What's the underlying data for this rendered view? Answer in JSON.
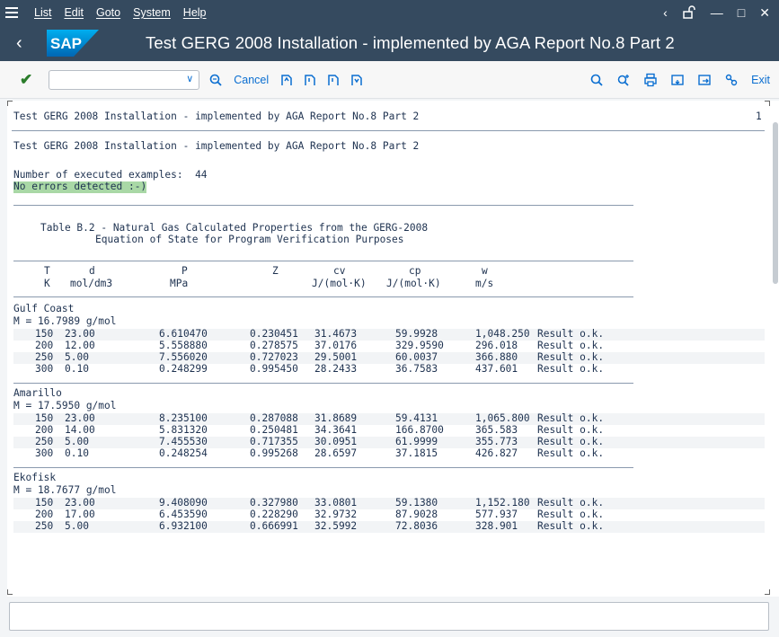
{
  "menubar": {
    "items": [
      "List",
      "Edit",
      "Goto",
      "System",
      "Help"
    ]
  },
  "titlebar": {
    "logo_text": "SAP",
    "title": "Test GERG 2008 Installation - implemented by AGA Report No.8 Part 2"
  },
  "toolbar": {
    "command_field_value": "",
    "cancel_label": "Cancel",
    "exit_label": "Exit"
  },
  "report": {
    "list_header": "Test GERG 2008 Installation - implemented by AGA Report No.8 Part 2",
    "page_number": "1",
    "title_line": "Test GERG 2008 Installation - implemented by AGA Report No.8 Part 2",
    "executed_examples": "Number of executed examples:  44",
    "no_errors": "No errors detected :-)",
    "table_title_1": "Table B.2 - Natural Gas Calculated Properties from the GERG-2008",
    "table_title_2": "Equation of State for Program Verification Purposes",
    "columns": [
      {
        "sym": "T",
        "unit": "K"
      },
      {
        "sym": "d",
        "unit": "mol/dm3"
      },
      {
        "sym": "P",
        "unit": "MPa"
      },
      {
        "sym": "Z",
        "unit": ""
      },
      {
        "sym": "cv",
        "unit": "J/(mol·K)"
      },
      {
        "sym": "cp",
        "unit": "J/(mol·K)"
      },
      {
        "sym": "w",
        "unit": "m/s"
      }
    ],
    "groups": [
      {
        "name": "Gulf Coast",
        "molar_mass": "M = 16.7989 g/mol",
        "rows": [
          [
            "150",
            "23.00",
            "6.610470",
            "0.230451",
            "31.4673",
            "59.9928",
            "1,048.250",
            "Result o.k."
          ],
          [
            "200",
            "12.00",
            "5.558880",
            "0.278575",
            "37.0176",
            "329.9590",
            "296.018",
            "Result o.k."
          ],
          [
            "250",
            "5.00",
            "7.556020",
            "0.727023",
            "29.5001",
            "60.0037",
            "366.880",
            "Result o.k."
          ],
          [
            "300",
            "0.10",
            "0.248299",
            "0.995450",
            "28.2433",
            "36.7583",
            "437.601",
            "Result o.k."
          ]
        ]
      },
      {
        "name": "Amarillo",
        "molar_mass": "M = 17.5950 g/mol",
        "rows": [
          [
            "150",
            "23.00",
            "8.235100",
            "0.287088",
            "31.8689",
            "59.4131",
            "1,065.800",
            "Result o.k."
          ],
          [
            "200",
            "14.00",
            "5.831320",
            "0.250481",
            "34.3641",
            "166.8700",
            "365.583",
            "Result o.k."
          ],
          [
            "250",
            "5.00",
            "7.455530",
            "0.717355",
            "30.0951",
            "61.9999",
            "355.773",
            "Result o.k."
          ],
          [
            "300",
            "0.10",
            "0.248254",
            "0.995268",
            "28.6597",
            "37.1815",
            "426.827",
            "Result o.k."
          ]
        ]
      },
      {
        "name": "Ekofisk",
        "molar_mass": "M = 18.7677 g/mol",
        "rows": [
          [
            "150",
            "23.00",
            "9.408090",
            "0.327980",
            "33.0801",
            "59.1380",
            "1,152.180",
            "Result o.k."
          ],
          [
            "200",
            "17.00",
            "6.453590",
            "0.228290",
            "32.9732",
            "87.9028",
            "577.937",
            "Result o.k."
          ],
          [
            "250",
            "5.00",
            "6.932100",
            "0.666991",
            "32.5992",
            "72.8036",
            "328.901",
            "Result o.k."
          ]
        ]
      }
    ]
  },
  "footer": {
    "input_value": ""
  },
  "colors": {
    "shell": "#354a5f",
    "accent": "#0a6ed1",
    "highlight": "#a9d8a6",
    "list_text": "#1e3250"
  }
}
